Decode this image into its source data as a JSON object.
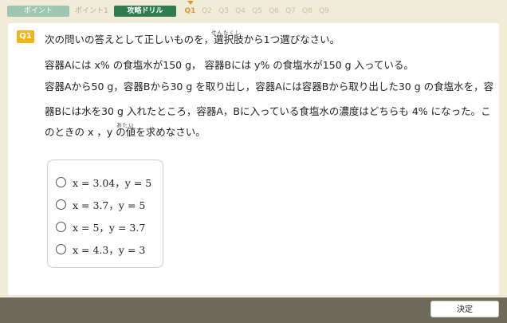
{
  "tabs": {
    "point": "ポイント",
    "point1": "ポイント1",
    "drill": "攻略ドリル"
  },
  "question_nav": [
    "Q1",
    "Q2",
    "Q3",
    "Q4",
    "Q5",
    "Q6",
    "Q7",
    "Q8",
    "Q9"
  ],
  "active_question": "Q1",
  "question": {
    "badge": "Q1",
    "line1": "次の問いの答えとして正しいものを，選択肢から1つ選びなさい。",
    "ruby1": "せんたくし",
    "line2": "容器Aには x% の食塩水が150 g， 容器Bには y% の食塩水が150 g 入っている。",
    "line3": "容器Aから50 g，容器Bから30 g を取り出し，容器Aには容器Bから取り出した30 g の食塩水を，容",
    "line4": "器Bには水を30 g 入れたところ，容器A，Bに入っている食塩水の濃度はどちらも 4% になった。こ",
    "line5": "のときの x ，y の値を求めなさい。",
    "ruby2": "あたい"
  },
  "choices": [
    "x = 3.04，y = 5",
    "x = 3.7，y = 5",
    "x = 5，y = 3.7",
    "x = 4.3，y = 3"
  ],
  "footer": {
    "decide_label": "決定"
  },
  "colors": {
    "background": "#f0ecd8",
    "drill_tab": "#2f7d4f",
    "point_tab": "#9ec6b0",
    "badge": "#f2b61a",
    "active_nav": "#e0942a",
    "footer": "#6e6a5a"
  }
}
